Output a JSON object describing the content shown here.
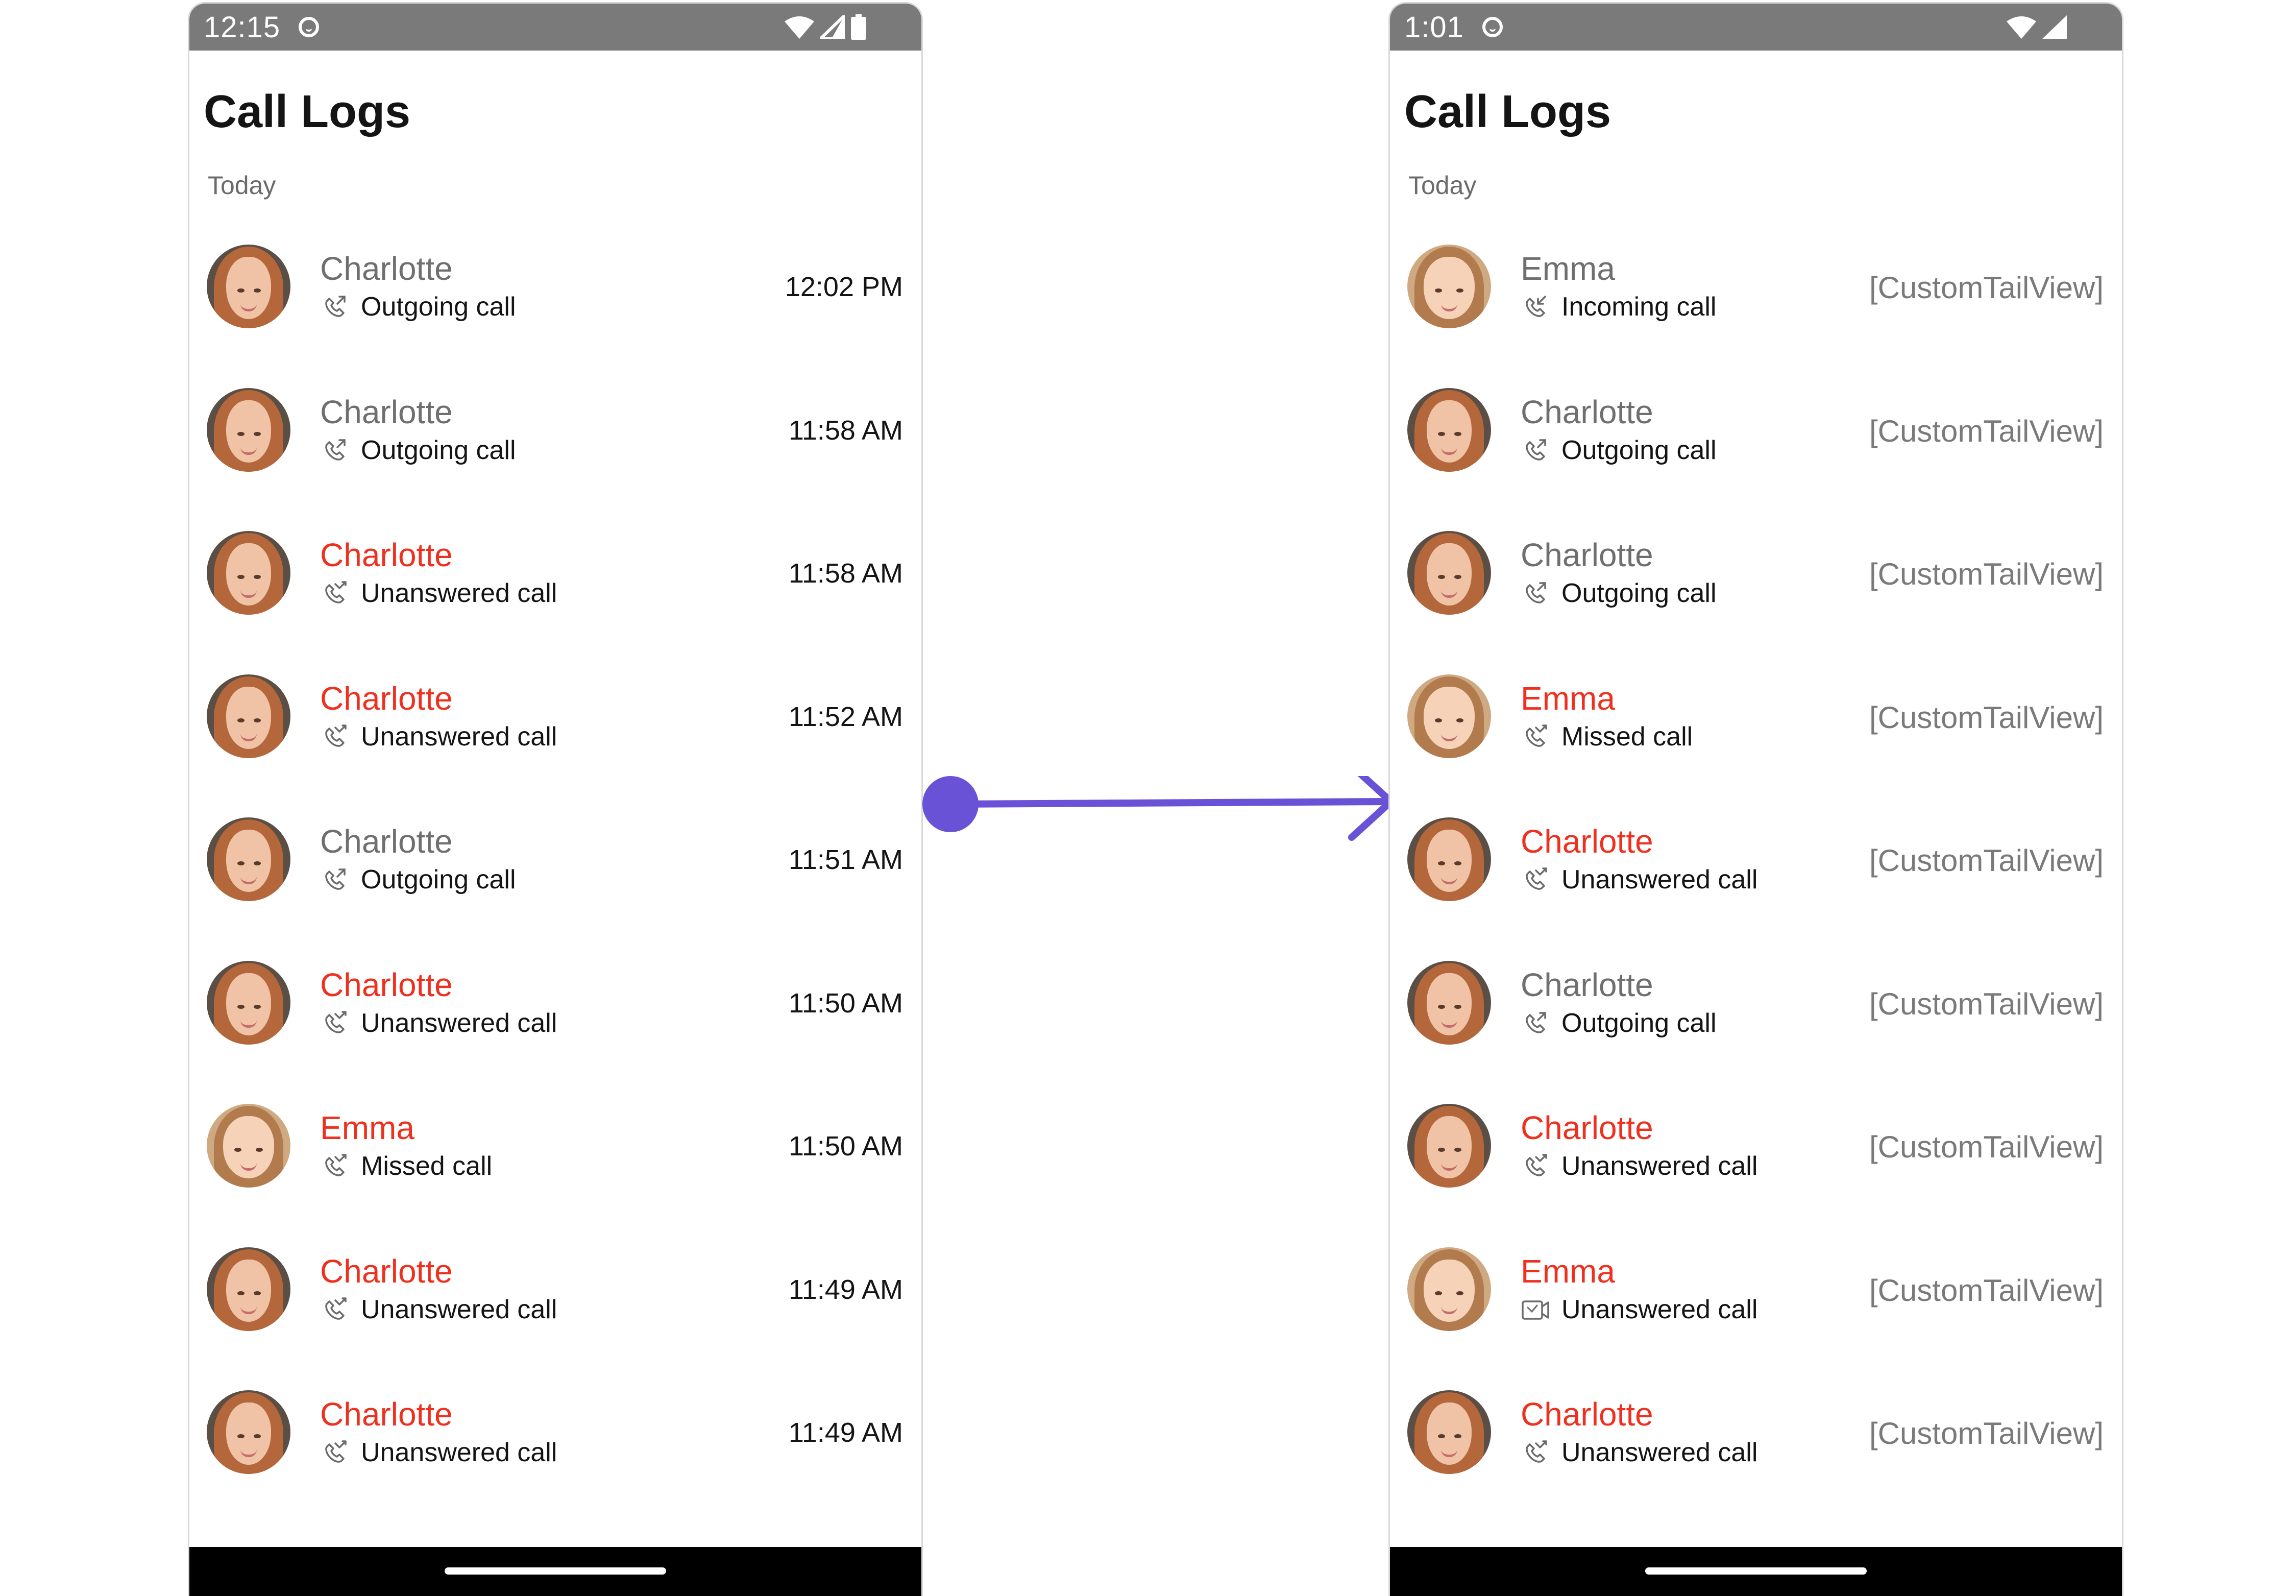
{
  "left_screen": {
    "status_time": "12:15",
    "title": "Call Logs",
    "section": "Today",
    "rows": [
      {
        "name": "Charlotte",
        "missed": false,
        "avatar": "charlotte",
        "icon": "outgoing-call-icon",
        "status": "Outgoing call",
        "time": "12:02 PM"
      },
      {
        "name": "Charlotte",
        "missed": false,
        "avatar": "charlotte",
        "icon": "outgoing-call-icon",
        "status": "Outgoing call",
        "time": "11:58 AM"
      },
      {
        "name": "Charlotte",
        "missed": true,
        "avatar": "charlotte",
        "icon": "missed-call-icon",
        "status": "Unanswered call",
        "time": "11:58 AM"
      },
      {
        "name": "Charlotte",
        "missed": true,
        "avatar": "charlotte",
        "icon": "missed-call-icon",
        "status": "Unanswered call",
        "time": "11:52 AM"
      },
      {
        "name": "Charlotte",
        "missed": false,
        "avatar": "charlotte",
        "icon": "outgoing-call-icon",
        "status": "Outgoing call",
        "time": "11:51 AM"
      },
      {
        "name": "Charlotte",
        "missed": true,
        "avatar": "charlotte",
        "icon": "missed-call-icon",
        "status": "Unanswered call",
        "time": "11:50 AM"
      },
      {
        "name": "Emma",
        "missed": true,
        "avatar": "emma",
        "icon": "missed-call-icon",
        "status": "Missed call",
        "time": "11:50 AM"
      },
      {
        "name": "Charlotte",
        "missed": true,
        "avatar": "charlotte",
        "icon": "missed-call-icon",
        "status": "Unanswered call",
        "time": "11:49 AM"
      },
      {
        "name": "Charlotte",
        "missed": true,
        "avatar": "charlotte",
        "icon": "missed-call-icon",
        "status": "Unanswered call",
        "time": "11:49 AM"
      }
    ]
  },
  "right_screen": {
    "status_time": "1:01",
    "title": "Call Logs",
    "section": "Today",
    "tail_text": "[CustomTailView]",
    "rows": [
      {
        "name": "Emma",
        "missed": false,
        "avatar": "emma",
        "icon": "incoming-call-icon",
        "status": "Incoming call"
      },
      {
        "name": "Charlotte",
        "missed": false,
        "avatar": "charlotte",
        "icon": "outgoing-call-icon",
        "status": "Outgoing call"
      },
      {
        "name": "Charlotte",
        "missed": false,
        "avatar": "charlotte",
        "icon": "outgoing-call-icon",
        "status": "Outgoing call"
      },
      {
        "name": "Emma",
        "missed": true,
        "avatar": "emma",
        "icon": "missed-call-icon",
        "status": "Missed call"
      },
      {
        "name": "Charlotte",
        "missed": true,
        "avatar": "charlotte",
        "icon": "missed-call-icon",
        "status": "Unanswered call"
      },
      {
        "name": "Charlotte",
        "missed": false,
        "avatar": "charlotte",
        "icon": "outgoing-call-icon",
        "status": "Outgoing call"
      },
      {
        "name": "Charlotte",
        "missed": true,
        "avatar": "charlotte",
        "icon": "missed-call-icon",
        "status": "Unanswered call"
      },
      {
        "name": "Emma",
        "missed": true,
        "avatar": "emma",
        "icon": "video-call-icon",
        "status": "Unanswered call"
      },
      {
        "name": "Charlotte",
        "missed": true,
        "avatar": "charlotte",
        "icon": "missed-call-icon",
        "status": "Unanswered call"
      }
    ]
  },
  "colors": {
    "missed_name": "#f0301f",
    "normal_name": "#6f6f6f",
    "status_bar": "#7a7a7a",
    "arrow": "#6a52d6"
  }
}
